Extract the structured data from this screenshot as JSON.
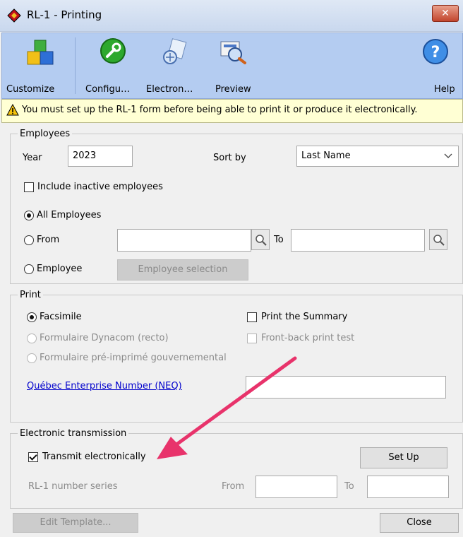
{
  "window": {
    "title": "RL-1 - Printing",
    "close_label": "✕"
  },
  "toolbar": {
    "customize": "Customize",
    "configure": "Configu…",
    "electronic": "Electron…",
    "preview": "Preview",
    "help": "Help"
  },
  "warning": {
    "text": "You must set up the RL-1 form before being able to print it or produce it electronically."
  },
  "employees": {
    "legend": "Employees",
    "year_label": "Year",
    "year_value": "2023",
    "sortby_label": "Sort by",
    "sortby_value": "Last Name",
    "include_inactive": "Include inactive employees",
    "all_employees": "All Employees",
    "from_label": "From",
    "to_label": "To",
    "employee_label": "Employee",
    "employee_selection": "Employee selection"
  },
  "print": {
    "legend": "Print",
    "facsimile": "Facsimile",
    "dynacom": "Formulaire Dynacom (recto)",
    "preprinted": "Formulaire pré-imprimé gouvernemental",
    "print_summary": "Print the Summary",
    "front_back": "Front-back print test",
    "neq_link": "Québec Enterprise Number (NEQ)"
  },
  "electronic": {
    "legend": "Electronic transmission",
    "transmit": "Transmit electronically",
    "setup": "Set Up",
    "number_series": "RL-1 number series",
    "from_label": "From",
    "to_label": "To"
  },
  "footer": {
    "edit_template": "Edit Template...",
    "close": "Close"
  },
  "annotation": {
    "arrow_color": "#e8336b"
  }
}
